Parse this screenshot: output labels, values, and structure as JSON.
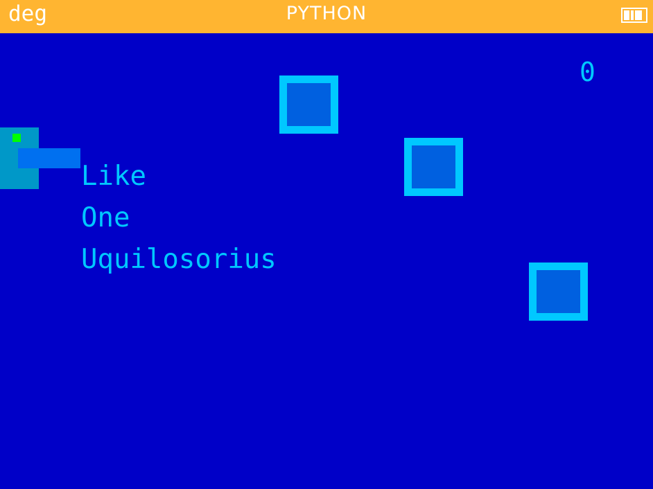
{
  "status_bar": {
    "angle_mode": "deg",
    "app_name": "PYTHON",
    "battery_icon": "battery-icon",
    "background_color": "#ffb531"
  },
  "game": {
    "score": "0",
    "menu": {
      "items": [
        "Like",
        "One",
        "Uquilosorius"
      ],
      "selected_index": 0
    },
    "colors": {
      "background": "#0000c8",
      "text": "#00c8ff",
      "tile_border": "#00c8ff",
      "tile_fill": "#0060e0",
      "player_block": "#0098c8",
      "player_dot": "#00ff00",
      "cursor": "#0070f0"
    },
    "tile_count": 3
  }
}
